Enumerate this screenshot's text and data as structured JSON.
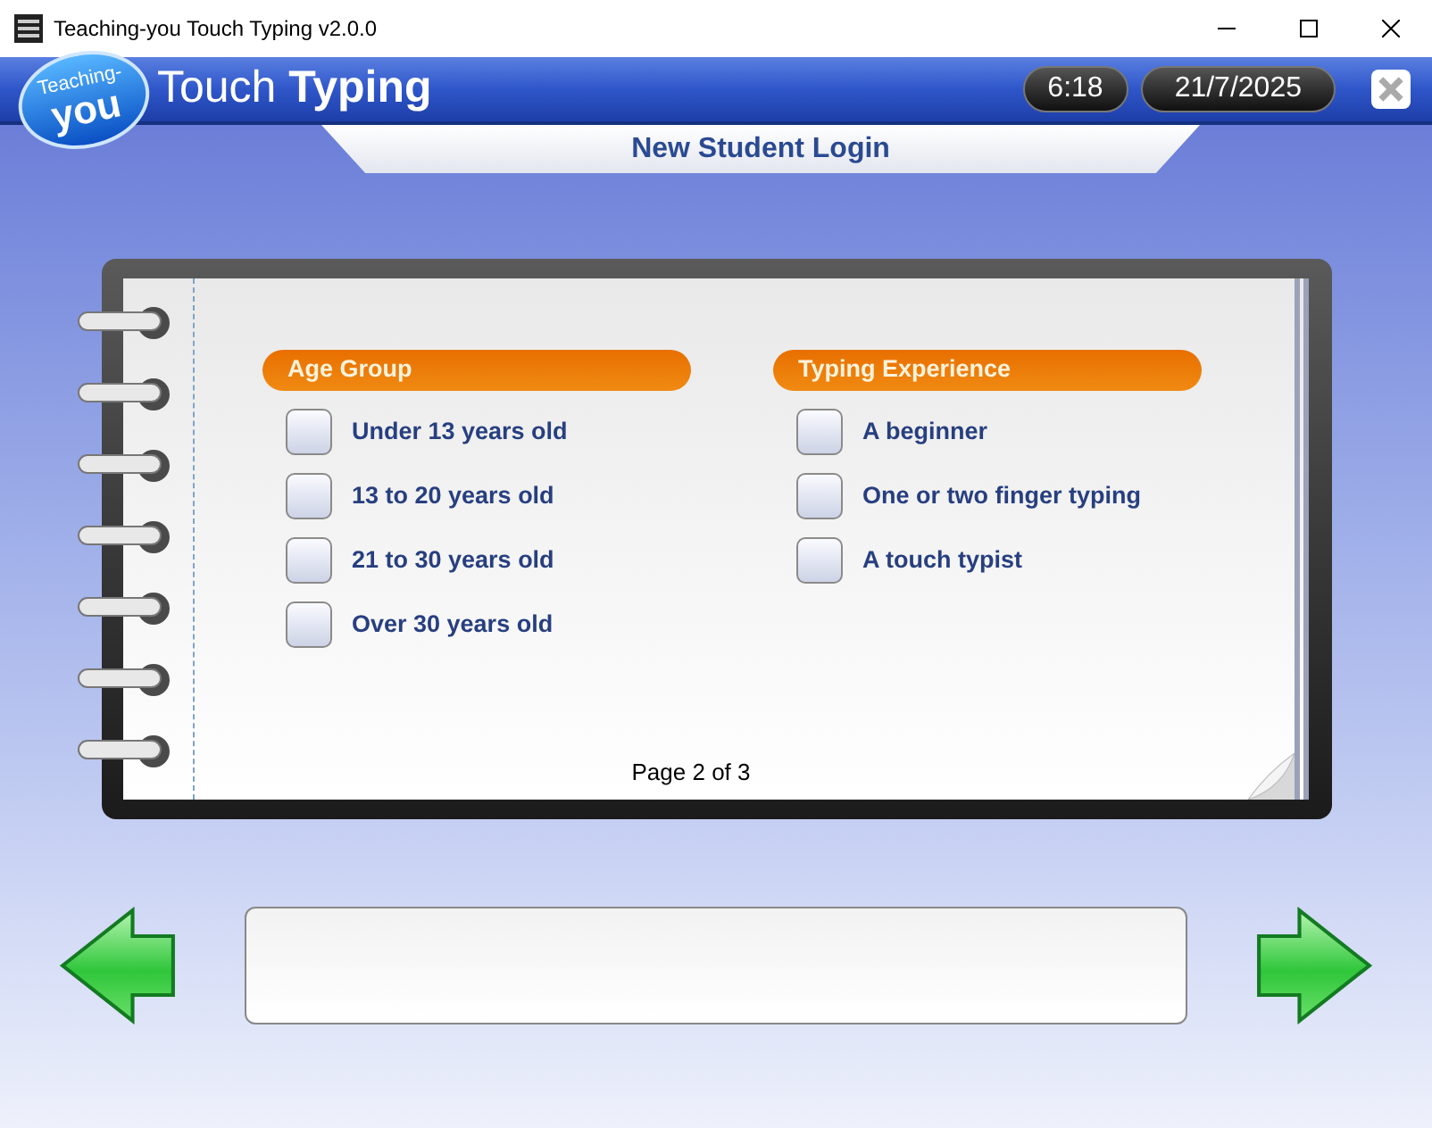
{
  "window": {
    "title": "Teaching-you Touch Typing v2.0.0"
  },
  "header": {
    "logo_top": "Teaching-",
    "logo_bottom": "you",
    "app_name_light": "Touch",
    "app_name_bold": "Typing",
    "time": "6:18",
    "date": "21/7/2025"
  },
  "banner": {
    "title": "New Student Login"
  },
  "groups": [
    {
      "title": "Age Group",
      "options": [
        {
          "label": "Under 13 years old",
          "checked": false
        },
        {
          "label": "13 to 20 years old",
          "checked": false
        },
        {
          "label": "21 to 30 years old",
          "checked": false
        },
        {
          "label": "Over 30 years old",
          "checked": false
        }
      ]
    },
    {
      "title": "Typing Experience",
      "options": [
        {
          "label": "A beginner",
          "checked": false
        },
        {
          "label": "One or two finger typing",
          "checked": false
        },
        {
          "label": "A touch typist",
          "checked": false
        }
      ]
    }
  ],
  "page_indicator": "Page 2 of 3"
}
